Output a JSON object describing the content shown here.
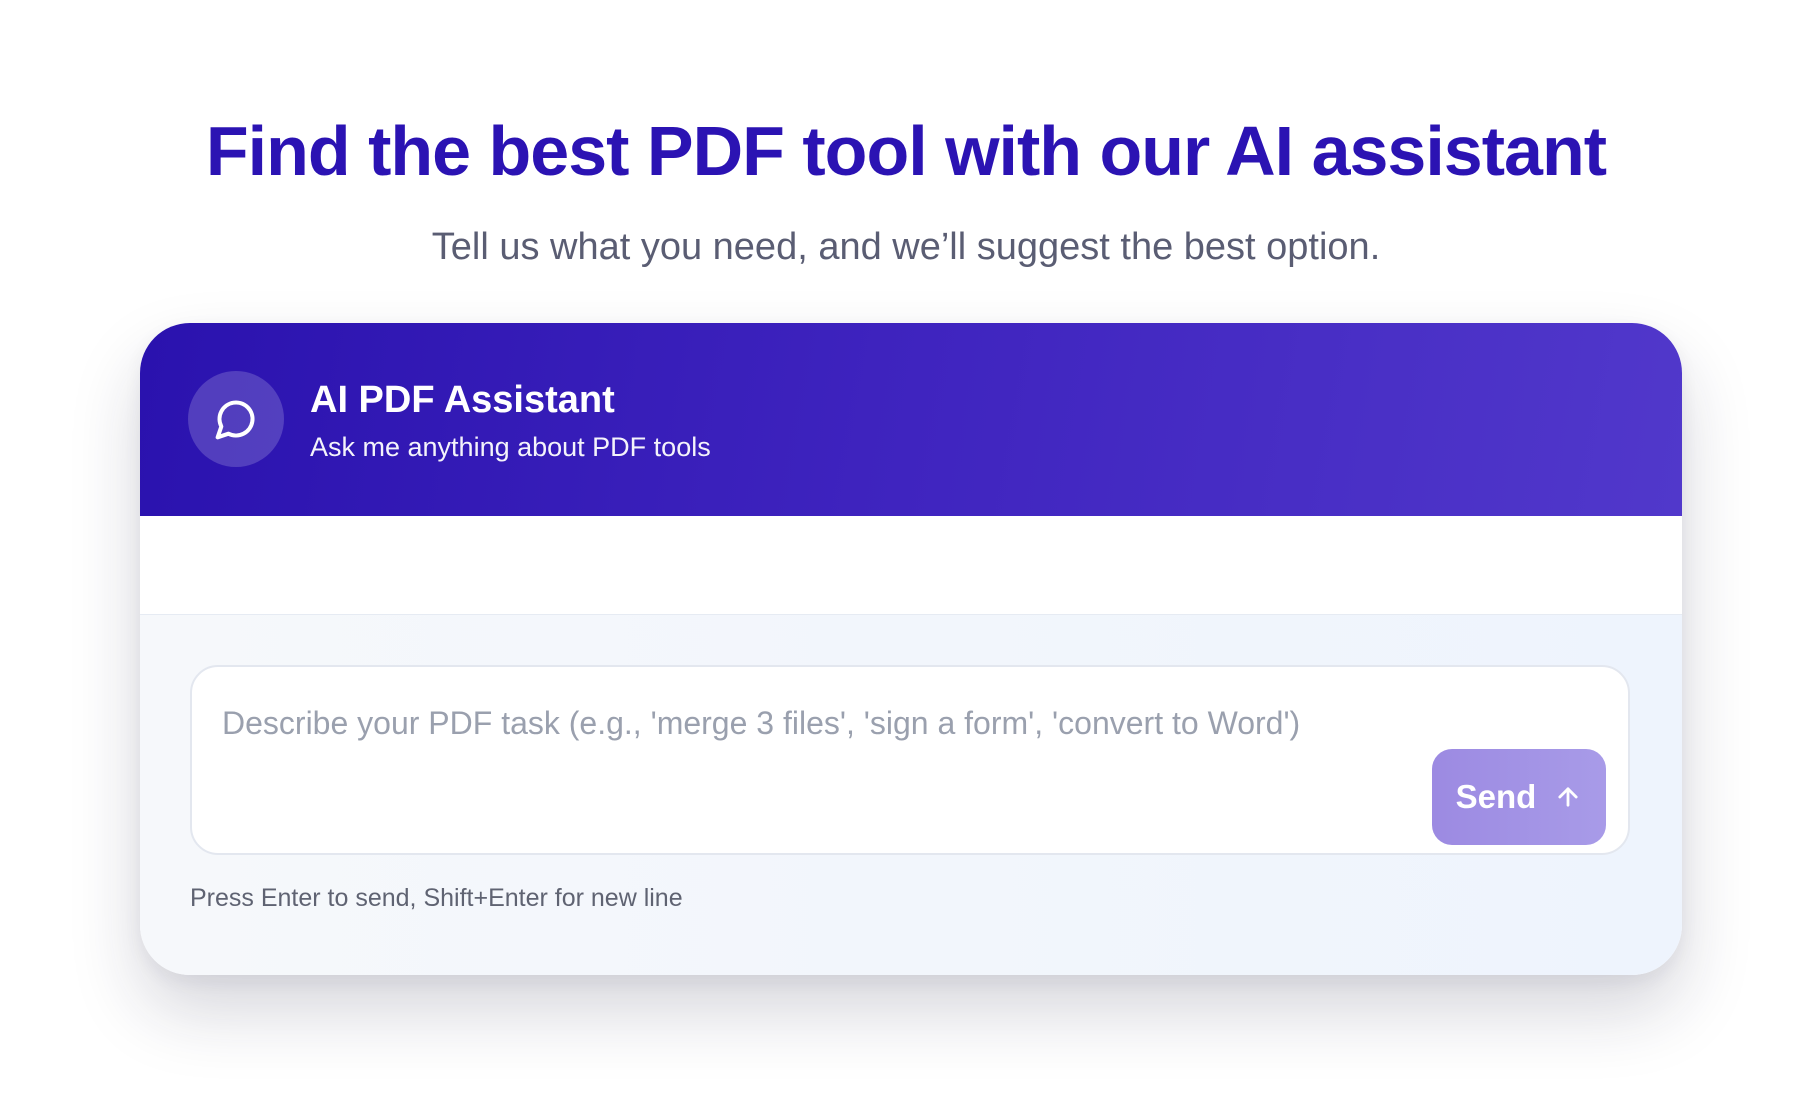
{
  "hero": {
    "title": "Find the best PDF tool with our AI assistant",
    "subtitle": "Tell us what you need, and we’ll suggest the best option."
  },
  "assistant": {
    "icon": "chat-bubble-icon",
    "title": "AI PDF Assistant",
    "subtitle": "Ask me anything about PDF tools"
  },
  "composer": {
    "input_value": "",
    "placeholder": "Describe your PDF task (e.g., 'merge 3 files', 'sign a form', 'convert to Word')",
    "send_label": "Send",
    "send_icon": "arrow-up-icon",
    "hint": "Press Enter to send, Shift+Enter for new line"
  },
  "colors": {
    "title": "#2b13b3",
    "header_gradient_start": "#2a12ae",
    "header_gradient_end": "#5138cb",
    "send_button": "#9c8ae2",
    "subtitle_text": "#5a5d73"
  }
}
